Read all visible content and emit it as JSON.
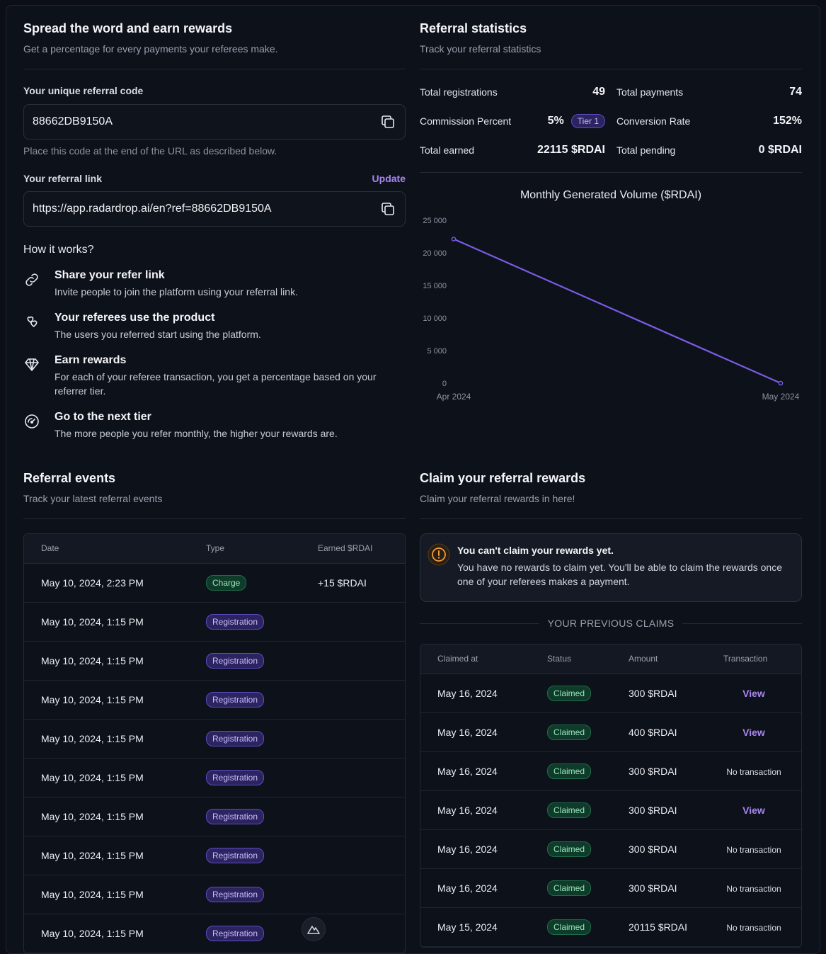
{
  "referral": {
    "title": "Spread the word and earn rewards",
    "subtitle": "Get a percentage for every payments your referees make.",
    "code_label": "Your unique referral code",
    "code_value": "88662DB9150A",
    "code_helper": "Place this code at the end of the URL as described below.",
    "link_label": "Your referral link",
    "update_label": "Update",
    "link_value": "https://app.radardrop.ai/en?ref=88662DB9150A",
    "how_title": "How it works?",
    "steps": [
      {
        "title": "Share your refer link",
        "desc": "Invite people to join the platform using your referral link.",
        "icon": "link-icon"
      },
      {
        "title": "Your referees use the product",
        "desc": "The users you referred start using the platform.",
        "icon": "hearts-icon"
      },
      {
        "title": "Earn rewards",
        "desc": "For each of your referee transaction, you get a percentage based on your referrer tier.",
        "icon": "diamond-icon"
      },
      {
        "title": "Go to the next tier",
        "desc": "The more people you refer monthly, the higher your rewards are.",
        "icon": "speedometer-icon"
      }
    ]
  },
  "stats": {
    "title": "Referral statistics",
    "subtitle": "Track your referral statistics",
    "total_registrations_label": "Total registrations",
    "total_registrations": "49",
    "total_payments_label": "Total payments",
    "total_payments": "74",
    "commission_label": "Commission Percent",
    "commission": "5%",
    "tier": "Tier 1",
    "conversion_label": "Conversion Rate",
    "conversion": "152%",
    "earned_label": "Total earned",
    "earned": "22115 $RDAI",
    "pending_label": "Total pending",
    "pending": "0 $RDAI"
  },
  "chart_data": {
    "type": "line",
    "title": "Monthly Generated Volume ($RDAI)",
    "categories": [
      "Apr 2024",
      "May 2024"
    ],
    "y_ticks": [
      "0",
      "5 000",
      "10 000",
      "15 000",
      "20 000",
      "25 000"
    ],
    "series": [
      {
        "values": [
          22115,
          0
        ]
      }
    ],
    "ylim": [
      0,
      25000
    ],
    "color": "#7b5be6"
  },
  "events": {
    "title": "Referral events",
    "subtitle": "Track your latest referral events",
    "columns": [
      "Date",
      "Type",
      "Earned $RDAI"
    ],
    "rows": [
      {
        "date": "May 10, 2024, 2:23 PM",
        "type": "Charge",
        "earned": "+15 $RDAI"
      },
      {
        "date": "May 10, 2024, 1:15 PM",
        "type": "Registration",
        "earned": ""
      },
      {
        "date": "May 10, 2024, 1:15 PM",
        "type": "Registration",
        "earned": ""
      },
      {
        "date": "May 10, 2024, 1:15 PM",
        "type": "Registration",
        "earned": ""
      },
      {
        "date": "May 10, 2024, 1:15 PM",
        "type": "Registration",
        "earned": ""
      },
      {
        "date": "May 10, 2024, 1:15 PM",
        "type": "Registration",
        "earned": ""
      },
      {
        "date": "May 10, 2024, 1:15 PM",
        "type": "Registration",
        "earned": ""
      },
      {
        "date": "May 10, 2024, 1:15 PM",
        "type": "Registration",
        "earned": ""
      },
      {
        "date": "May 10, 2024, 1:15 PM",
        "type": "Registration",
        "earned": ""
      },
      {
        "date": "May 10, 2024, 1:15 PM",
        "type": "Registration",
        "earned": ""
      }
    ]
  },
  "claim": {
    "title": "Claim your referral rewards",
    "subtitle": "Claim your referral rewards in here!",
    "alert_title": "You can't claim your rewards yet.",
    "alert_desc": "You have no rewards to claim yet. You'll be able to claim the rewards once one of your referees makes a payment.",
    "previous_label": "YOUR PREVIOUS CLAIMS",
    "columns": [
      "Claimed at",
      "Status",
      "Amount",
      "Transaction"
    ],
    "rows": [
      {
        "date": "May 16, 2024",
        "status": "Claimed",
        "amount": "300 $RDAI",
        "tx": "View"
      },
      {
        "date": "May 16, 2024",
        "status": "Claimed",
        "amount": "400 $RDAI",
        "tx": "View"
      },
      {
        "date": "May 16, 2024",
        "status": "Claimed",
        "amount": "300 $RDAI",
        "tx": "No transaction"
      },
      {
        "date": "May 16, 2024",
        "status": "Claimed",
        "amount": "300 $RDAI",
        "tx": "View"
      },
      {
        "date": "May 16, 2024",
        "status": "Claimed",
        "amount": "300 $RDAI",
        "tx": "No transaction"
      },
      {
        "date": "May 16, 2024",
        "status": "Claimed",
        "amount": "300 $RDAI",
        "tx": "No transaction"
      },
      {
        "date": "May 15, 2024",
        "status": "Claimed",
        "amount": "20115 $RDAI",
        "tx": "No transaction"
      }
    ]
  }
}
